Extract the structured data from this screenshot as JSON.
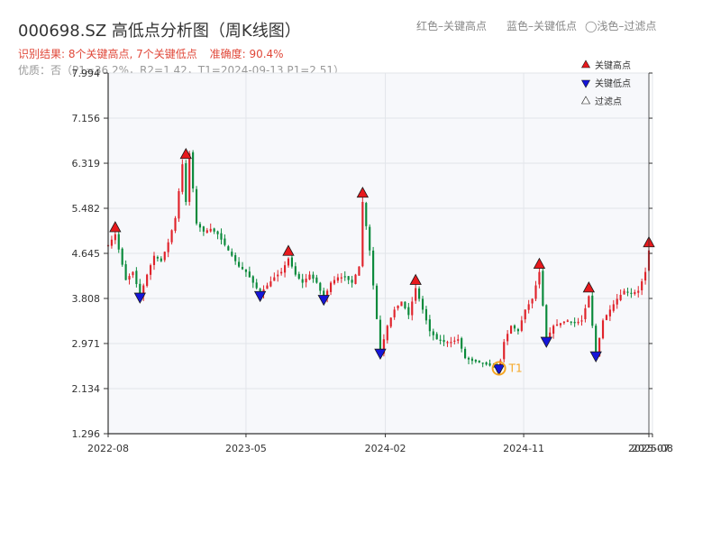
{
  "header": {
    "title": "000698.SZ 高低点分析图（周K线图）",
    "legend_red": "红色–关键高点",
    "legend_blue": "蓝色–关键低点",
    "legend_light": "◯浅色–过滤点",
    "result": "识别结果: 8个关键高点, 7个关键低点",
    "accuracy": "准确度: 90.4%",
    "quality": "优质：否（P1=36.2%，R2=1.42，T1=2024-09-13 P1=2.51）"
  },
  "colors": {
    "up": "#e0232b",
    "down": "#0a8a3b",
    "high_marker": "#e8191d",
    "low_marker": "#1515d9",
    "t1_ring": "#f5a623",
    "plot_bg": "#f7f8fb",
    "grid": "#e2e5ea",
    "axis": "#333333"
  },
  "chart_data": {
    "type": "candlestick",
    "title": "000698.SZ 高低点分析图（周K线图）",
    "interval": "weekly",
    "ylim": [
      1.296,
      7.994
    ],
    "y_ticks": [
      1.296,
      2.134,
      2.971,
      3.808,
      4.645,
      5.482,
      6.319,
      7.156,
      7.994
    ],
    "y_tick_labels": [
      "1.296",
      "2.134",
      "2.971",
      "3.808",
      "4.645",
      "5.482",
      "6.319",
      "7.156",
      "7.994"
    ],
    "x_start": "2022-08-01",
    "x_end": "2025-07-07",
    "x_ticks": [
      {
        "label": "2022-08",
        "date": "2022-08-01"
      },
      {
        "label": "2023-05",
        "date": "2023-05-01"
      },
      {
        "label": "2024-02",
        "date": "2024-02-01"
      },
      {
        "label": "2024-11",
        "date": "2024-11-01"
      },
      {
        "label": "2025-07",
        "date": "2025-07-07"
      },
      {
        "label": "2025-08",
        "date": "2025-07-14"
      }
    ],
    "grid": true,
    "legend_position": "top-right",
    "path": [
      [
        "2022-08-01",
        4.8
      ],
      [
        "2022-08-15",
        5.0
      ],
      [
        "2022-09-05",
        4.15
      ],
      [
        "2022-09-19",
        4.3
      ],
      [
        "2022-10-03",
        3.85
      ],
      [
        "2022-10-17",
        4.25
      ],
      [
        "2022-10-31",
        4.6
      ],
      [
        "2022-11-14",
        4.5
      ],
      [
        "2022-11-28",
        4.85
      ],
      [
        "2022-12-12",
        5.3
      ],
      [
        "2022-12-26",
        6.3
      ],
      [
        "2023-01-02",
        5.6
      ],
      [
        "2023-01-09",
        6.5
      ],
      [
        "2023-01-23",
        5.2
      ],
      [
        "2023-02-06",
        5.05
      ],
      [
        "2023-02-20",
        5.1
      ],
      [
        "2023-03-06",
        5.0
      ],
      [
        "2023-03-20",
        4.8
      ],
      [
        "2023-04-03",
        4.6
      ],
      [
        "2023-04-17",
        4.4
      ],
      [
        "2023-05-01",
        4.3
      ],
      [
        "2023-05-15",
        4.1
      ],
      [
        "2023-05-29",
        3.9
      ],
      [
        "2023-06-12",
        4.05
      ],
      [
        "2023-06-26",
        4.2
      ],
      [
        "2023-07-10",
        4.3
      ],
      [
        "2023-07-24",
        4.55
      ],
      [
        "2023-08-07",
        4.25
      ],
      [
        "2023-08-21",
        4.1
      ],
      [
        "2023-09-04",
        4.25
      ],
      [
        "2023-09-18",
        4.1
      ],
      [
        "2023-10-02",
        3.8
      ],
      [
        "2023-10-16",
        4.1
      ],
      [
        "2023-10-30",
        4.2
      ],
      [
        "2023-11-13",
        4.2
      ],
      [
        "2023-11-27",
        4.1
      ],
      [
        "2023-12-11",
        4.4
      ],
      [
        "2023-12-18",
        5.6
      ],
      [
        "2024-01-01",
        4.7
      ],
      [
        "2024-01-08",
        4.05
      ],
      [
        "2024-01-22",
        2.8
      ],
      [
        "2024-02-05",
        3.3
      ],
      [
        "2024-02-19",
        3.6
      ],
      [
        "2024-03-04",
        3.75
      ],
      [
        "2024-03-18",
        3.5
      ],
      [
        "2024-04-01",
        4.0
      ],
      [
        "2024-04-15",
        3.6
      ],
      [
        "2024-04-29",
        3.2
      ],
      [
        "2024-05-13",
        3.05
      ],
      [
        "2024-05-27",
        3.0
      ],
      [
        "2024-06-10",
        3.0
      ],
      [
        "2024-06-24",
        3.05
      ],
      [
        "2024-07-08",
        2.7
      ],
      [
        "2024-07-22",
        2.65
      ],
      [
        "2024-08-05",
        2.62
      ],
      [
        "2024-08-19",
        2.58
      ],
      [
        "2024-09-13",
        2.51
      ],
      [
        "2024-09-23",
        3.0
      ],
      [
        "2024-10-07",
        3.3
      ],
      [
        "2024-10-21",
        3.2
      ],
      [
        "2024-11-04",
        3.6
      ],
      [
        "2024-11-18",
        3.8
      ],
      [
        "2024-12-02",
        4.3
      ],
      [
        "2024-12-16",
        3.05
      ],
      [
        "2024-12-30",
        3.3
      ],
      [
        "2025-01-13",
        3.35
      ],
      [
        "2025-01-27",
        3.4
      ],
      [
        "2025-02-10",
        3.35
      ],
      [
        "2025-02-24",
        3.4
      ],
      [
        "2025-03-10",
        3.85
      ],
      [
        "2025-03-24",
        2.75
      ],
      [
        "2025-04-07",
        3.4
      ],
      [
        "2025-04-21",
        3.6
      ],
      [
        "2025-05-05",
        3.8
      ],
      [
        "2025-05-19",
        3.95
      ],
      [
        "2025-06-02",
        3.9
      ],
      [
        "2025-06-16",
        3.95
      ],
      [
        "2025-06-30",
        4.3
      ],
      [
        "2025-07-07",
        4.7
      ],
      [
        "2025-07-14",
        4.1
      ]
    ],
    "key_highs": [
      {
        "date": "2022-08-15",
        "value": 4.98
      },
      {
        "date": "2023-01-02",
        "value": 6.34
      },
      {
        "date": "2023-07-24",
        "value": 4.54
      },
      {
        "date": "2023-12-18",
        "value": 5.62
      },
      {
        "date": "2024-04-01",
        "value": 4.0
      },
      {
        "date": "2024-12-02",
        "value": 4.3
      },
      {
        "date": "2025-03-10",
        "value": 3.86
      },
      {
        "date": "2025-07-07",
        "value": 4.7
      }
    ],
    "key_lows": [
      {
        "date": "2022-10-03",
        "value": 3.84
      },
      {
        "date": "2023-05-29",
        "value": 3.87
      },
      {
        "date": "2023-10-02",
        "value": 3.8
      },
      {
        "date": "2024-01-22",
        "value": 2.8
      },
      {
        "date": "2024-09-13",
        "value": 2.51
      },
      {
        "date": "2024-12-16",
        "value": 3.02
      },
      {
        "date": "2025-03-24",
        "value": 2.75
      }
    ],
    "t1_point": {
      "date": "2024-09-13",
      "value": 2.51,
      "label": "T1"
    },
    "legend": [
      "关键高点",
      "关键低点",
      "过滤点"
    ]
  }
}
